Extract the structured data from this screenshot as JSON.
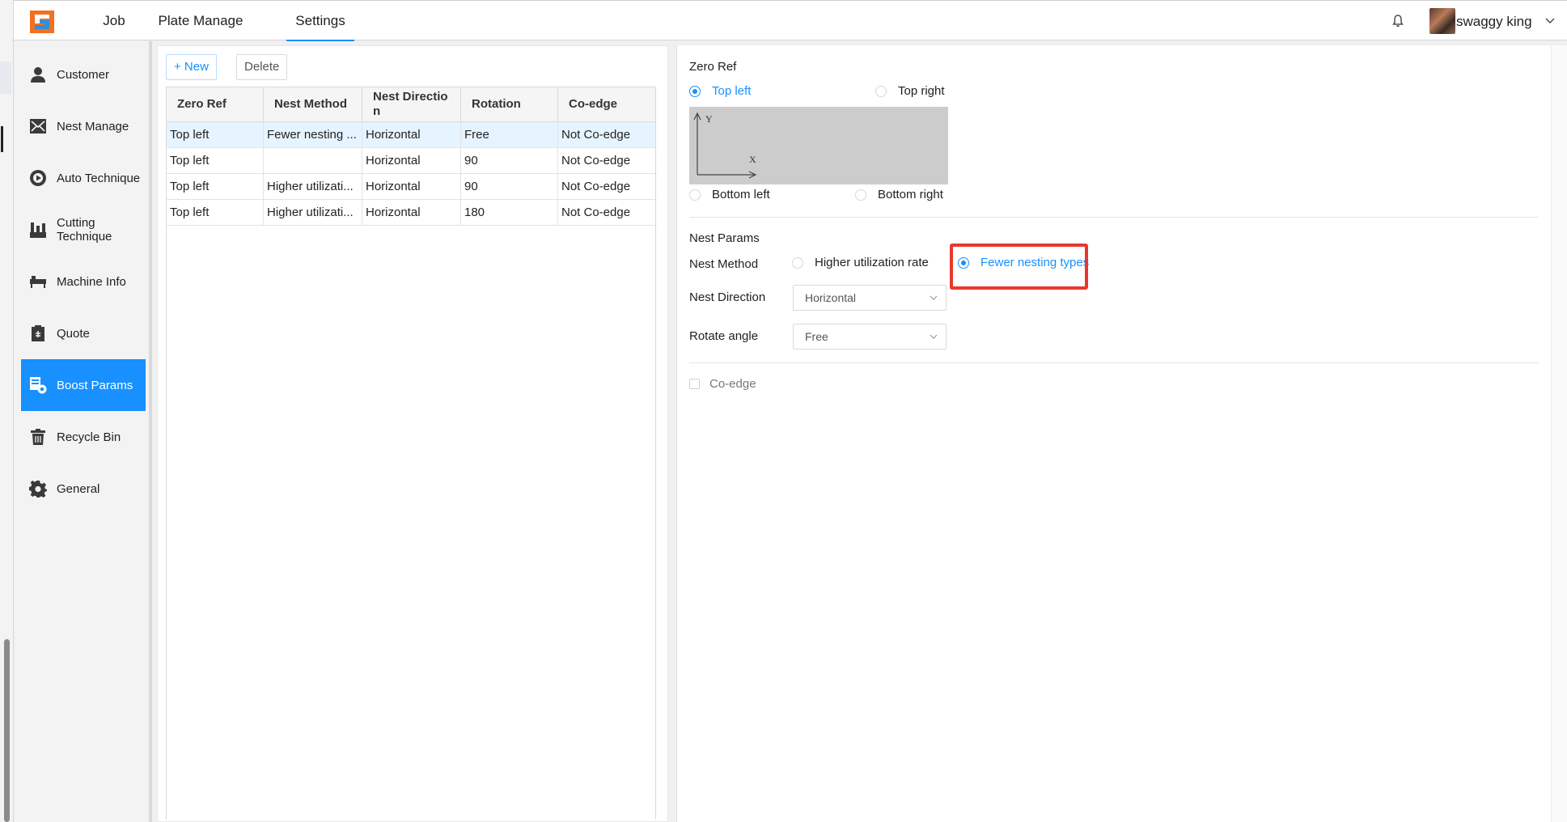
{
  "nav": {
    "tabs": [
      "Job",
      "Plate Manage",
      "Settings"
    ],
    "active_tab": "Settings",
    "user_name": "swaggy king"
  },
  "sidebar": {
    "items": [
      {
        "label": "Customer",
        "icon": "person-icon"
      },
      {
        "label": "Nest Manage",
        "icon": "nest-icon"
      },
      {
        "label": "Auto Technique",
        "icon": "auto-technique-icon"
      },
      {
        "label": "Cutting Technique",
        "icon": "cutting-technique-icon"
      },
      {
        "label": "Machine Info",
        "icon": "machine-icon"
      },
      {
        "label": "Quote",
        "icon": "quote-icon"
      },
      {
        "label": "Boost Params",
        "icon": "boost-params-icon"
      },
      {
        "label": "Recycle Bin",
        "icon": "trash-icon"
      },
      {
        "label": "General",
        "icon": "gear-icon"
      }
    ],
    "active": "Boost Params"
  },
  "toolbar": {
    "new_label": "+ New",
    "delete_label": "Delete"
  },
  "table": {
    "columns": [
      "Zero Ref",
      "Nest Method",
      "Nest Directio n",
      "Rotation",
      "Co-edge"
    ],
    "rows": [
      [
        "Top left",
        "Fewer nesting ...",
        "Horizontal",
        "Free",
        "Not Co-edge"
      ],
      [
        "Top left",
        "",
        "Horizontal",
        "90",
        "Not Co-edge"
      ],
      [
        "Top left",
        "Higher utilizati...",
        "Horizontal",
        "90",
        "Not Co-edge"
      ],
      [
        "Top left",
        "Higher utilizati...",
        "Horizontal",
        "180",
        "Not Co-edge"
      ]
    ],
    "selected_row": 0
  },
  "zero_ref": {
    "title": "Zero Ref",
    "options": [
      "Top left",
      "Top right",
      "Bottom left",
      "Bottom right"
    ],
    "selected": "Top left",
    "axis_y": "Y",
    "axis_x": "X"
  },
  "nest_params": {
    "title": "Nest Params",
    "method_label": "Nest Method",
    "method_options": [
      "Higher utilization rate",
      "Fewer nesting types"
    ],
    "method_selected": "Fewer nesting types",
    "direction_label": "Nest Direction",
    "direction_value": "Horizontal",
    "rotate_label": "Rotate angle",
    "rotate_value": "Free",
    "coedge_label": "Co-edge",
    "coedge_checked": false
  },
  "colors": {
    "accent": "#1890ff",
    "highlight_box": "#e8382c",
    "preview_bg": "#cccccc"
  }
}
